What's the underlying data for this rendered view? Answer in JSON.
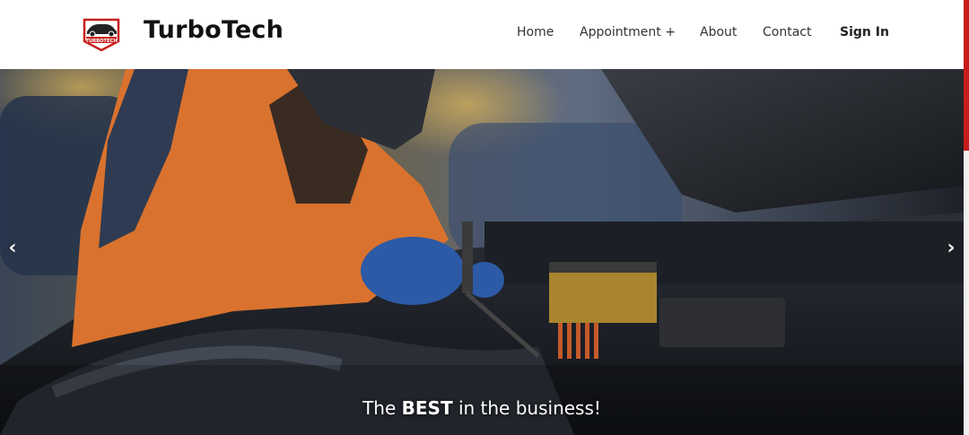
{
  "header": {
    "brand": "TurboTech",
    "logo_text": "TURBOTECH",
    "nav": [
      {
        "label": "Home"
      },
      {
        "label": "Appointment +"
      },
      {
        "label": "About"
      },
      {
        "label": "Contact"
      },
      {
        "label": "Sign In"
      }
    ]
  },
  "hero": {
    "caption_pre": "The ",
    "caption_bold": "BEST",
    "caption_post": " in the business!",
    "prev_arrow": "‹",
    "next_arrow": "›"
  },
  "colors": {
    "accent": "#c81d1d",
    "text": "#111111"
  }
}
